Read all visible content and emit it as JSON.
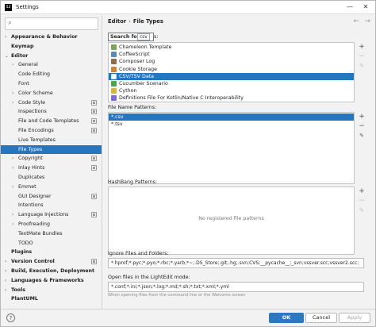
{
  "window": {
    "title": "Settings"
  },
  "breadcrumb": {
    "parent": "Editor",
    "separator": "›",
    "current": "File Types"
  },
  "sidebar": {
    "search_value": "",
    "items": [
      {
        "label": "Appearance & Behavior",
        "level": 0,
        "arrow": "›",
        "bold": true,
        "selected": false,
        "project": false
      },
      {
        "label": "Keymap",
        "level": 0,
        "arrow": "",
        "bold": true,
        "selected": false,
        "project": false
      },
      {
        "label": "Editor",
        "level": 0,
        "arrow": "⌄",
        "bold": true,
        "selected": false,
        "project": false
      },
      {
        "label": "General",
        "level": 1,
        "arrow": "›",
        "bold": false,
        "selected": false,
        "project": false
      },
      {
        "label": "Code Editing",
        "level": 1,
        "arrow": "",
        "bold": false,
        "selected": false,
        "project": false
      },
      {
        "label": "Font",
        "level": 1,
        "arrow": "",
        "bold": false,
        "selected": false,
        "project": false
      },
      {
        "label": "Color Scheme",
        "level": 1,
        "arrow": "›",
        "bold": false,
        "selected": false,
        "project": false
      },
      {
        "label": "Code Style",
        "level": 1,
        "arrow": "›",
        "bold": false,
        "selected": false,
        "project": true
      },
      {
        "label": "Inspections",
        "level": 1,
        "arrow": "",
        "bold": false,
        "selected": false,
        "project": true
      },
      {
        "label": "File and Code Templates",
        "level": 1,
        "arrow": "",
        "bold": false,
        "selected": false,
        "project": true
      },
      {
        "label": "File Encodings",
        "level": 1,
        "arrow": "",
        "bold": false,
        "selected": false,
        "project": true
      },
      {
        "label": "Live Templates",
        "level": 1,
        "arrow": "",
        "bold": false,
        "selected": false,
        "project": false
      },
      {
        "label": "File Types",
        "level": 1,
        "arrow": "",
        "bold": false,
        "selected": true,
        "project": false
      },
      {
        "label": "Copyright",
        "level": 1,
        "arrow": "›",
        "bold": false,
        "selected": false,
        "project": true
      },
      {
        "label": "Inlay Hints",
        "level": 1,
        "arrow": "›",
        "bold": false,
        "selected": false,
        "project": true
      },
      {
        "label": "Duplicates",
        "level": 1,
        "arrow": "",
        "bold": false,
        "selected": false,
        "project": false
      },
      {
        "label": "Emmet",
        "level": 1,
        "arrow": "›",
        "bold": false,
        "selected": false,
        "project": false
      },
      {
        "label": "GUI Designer",
        "level": 1,
        "arrow": "",
        "bold": false,
        "selected": false,
        "project": true
      },
      {
        "label": "Intentions",
        "level": 1,
        "arrow": "",
        "bold": false,
        "selected": false,
        "project": false
      },
      {
        "label": "Language Injections",
        "level": 1,
        "arrow": "›",
        "bold": false,
        "selected": false,
        "project": true
      },
      {
        "label": "Proofreading",
        "level": 1,
        "arrow": "›",
        "bold": false,
        "selected": false,
        "project": false
      },
      {
        "label": "TextMate Bundles",
        "level": 1,
        "arrow": "",
        "bold": false,
        "selected": false,
        "project": false
      },
      {
        "label": "TODO",
        "level": 1,
        "arrow": "",
        "bold": false,
        "selected": false,
        "project": false
      },
      {
        "label": "Plugins",
        "level": 0,
        "arrow": "",
        "bold": true,
        "selected": false,
        "project": false
      },
      {
        "label": "Version Control",
        "level": 0,
        "arrow": "›",
        "bold": true,
        "selected": false,
        "project": true
      },
      {
        "label": "Build, Execution, Deployment",
        "level": 0,
        "arrow": "›",
        "bold": true,
        "selected": false,
        "project": false
      },
      {
        "label": "Languages & Frameworks",
        "level": 0,
        "arrow": "›",
        "bold": true,
        "selected": false,
        "project": false
      },
      {
        "label": "Tools",
        "level": 0,
        "arrow": "›",
        "bold": true,
        "selected": false,
        "project": false
      },
      {
        "label": "PlantUML",
        "level": 0,
        "arrow": "",
        "bold": true,
        "selected": false,
        "project": false
      }
    ]
  },
  "file_types": {
    "label_tail": "s:",
    "search_popup": {
      "label": "Search for:",
      "value": "csv"
    },
    "items": [
      {
        "label": "Chameleon Template",
        "icon_color": "#7aa65b",
        "selected": false
      },
      {
        "label": "CoffeeScript",
        "icon_color": "#5b8bb5",
        "selected": false
      },
      {
        "label": "Composer Log",
        "icon_color": "#8c6d4f",
        "selected": false
      },
      {
        "label": "Cookie Storage",
        "icon_color": "#c7883a",
        "selected": false
      },
      {
        "label": "CSV/TSV Data",
        "icon_color": "#ffffff",
        "selected": true
      },
      {
        "label": "Cucumber Scenario",
        "icon_color": "#4aa651",
        "selected": false
      },
      {
        "label": "Cython",
        "icon_color": "#d9b33a",
        "selected": false
      },
      {
        "label": "Definitions File For Kotlin/Native C Interoperability",
        "icon_color": "#7f6bd0",
        "selected": false
      }
    ]
  },
  "file_name_patterns": {
    "label": "File Name Patterns:",
    "items": [
      {
        "label": "*.csv",
        "selected": true
      },
      {
        "label": "*.tsv",
        "selected": false
      }
    ]
  },
  "hashbang_patterns": {
    "label": "HashBang Patterns:",
    "empty_text": "No registered file patterns"
  },
  "ignore_files": {
    "label": "Ignore Files and Folders:",
    "value": "*.hprof;*.pyc;*.pyo;*.rbc;*.yarb;*~;.DS_Store;.git;.hg;.svn;CVS;__pycache__;_svn;vssver.scc;vssver2.scc;"
  },
  "lightedit": {
    "label": "Open files in the LightEdit mode:",
    "value": "*.conf;*.ini;*.json;*.log;*.md;*.sh;*.txt;*.xml;*.yml",
    "hint": "When opening files from the command line or the Welcome screen"
  },
  "buttons": {
    "ok": "OK",
    "cancel": "Cancel",
    "apply": "Apply"
  },
  "glyphs": {
    "add": "+",
    "remove": "−",
    "edit": "✎",
    "back": "←",
    "forward": "→",
    "help": "?",
    "search": "⌕",
    "minimize": "—",
    "close": "✕"
  }
}
